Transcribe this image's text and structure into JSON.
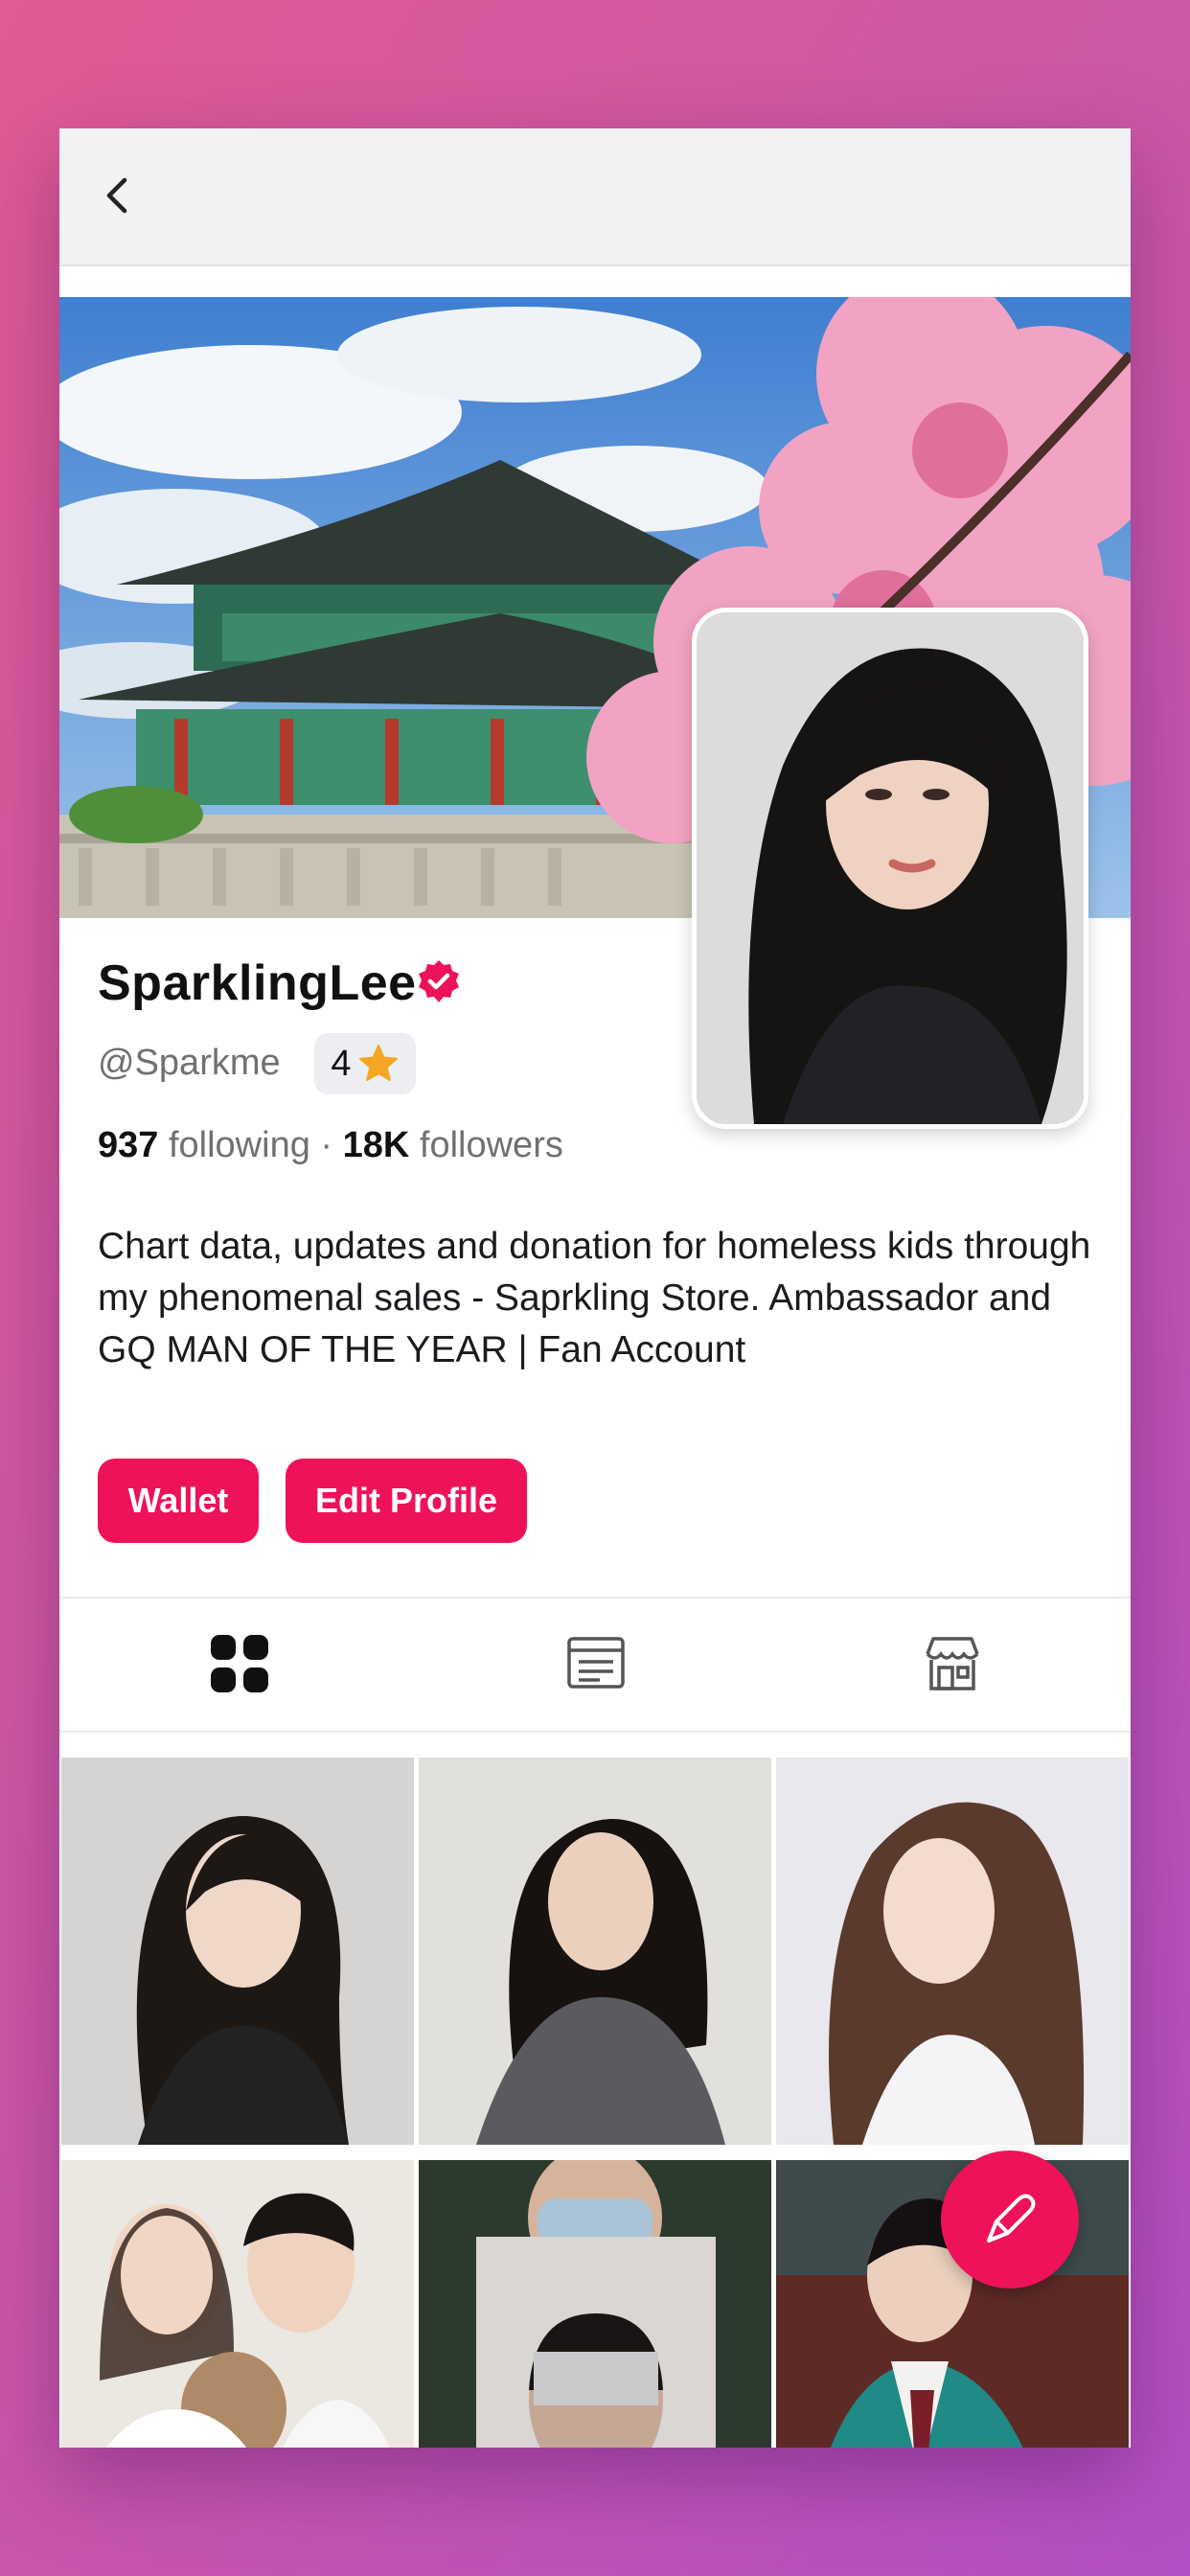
{
  "header": {
    "back_icon": "chevron-left-icon"
  },
  "profile": {
    "name": "SparklingLee",
    "handle": "@Sparkme",
    "badge_count": "4",
    "following_count": "937",
    "following_label": "following",
    "separator": "·",
    "followers_count": "18K",
    "followers_label": "followers",
    "bio": "Chart data, updates and donation for homeless kids through my phenomenal sales - Saprkling Store. Ambassador and GQ MAN OF THE YEAR | Fan Account"
  },
  "actions": {
    "wallet_label": "Wallet",
    "edit_label": "Edit Profile"
  },
  "tabs": [
    {
      "icon": "grid-icon",
      "active": true
    },
    {
      "icon": "news-icon",
      "active": false
    },
    {
      "icon": "store-icon",
      "active": false
    }
  ],
  "colors": {
    "accent": "#ee1259",
    "star": "#f5a623",
    "background_gradient_start": "#e05a93",
    "background_gradient_end": "#b34fc4"
  },
  "fab": {
    "icon": "compose-icon"
  }
}
